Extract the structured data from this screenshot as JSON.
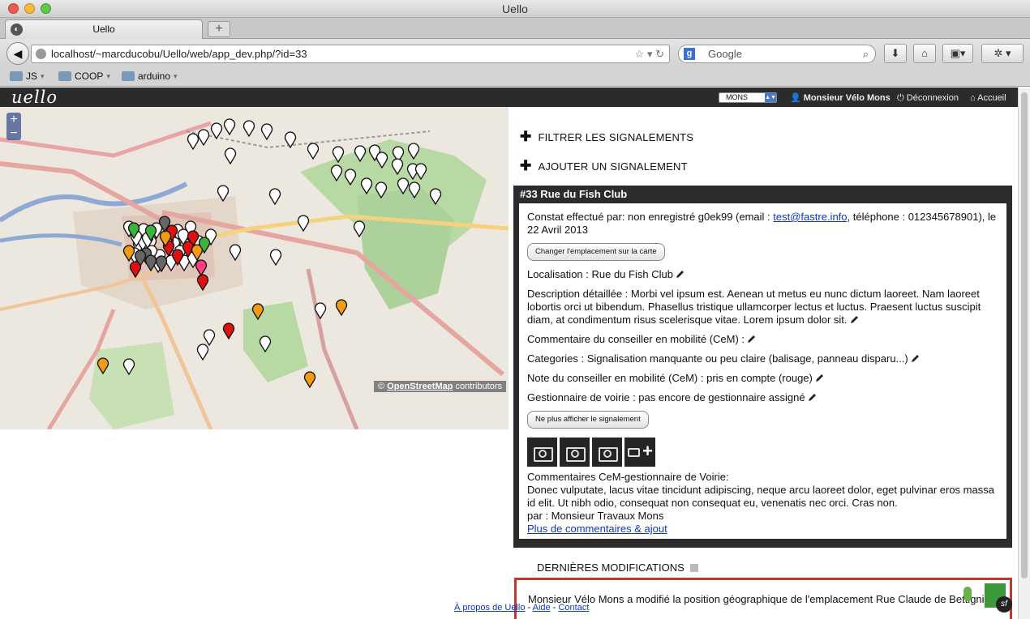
{
  "window": {
    "title": "Uello"
  },
  "browser": {
    "tab_label": "Uello",
    "new_tab": "+",
    "url": "localhost/~marcducobu/Uello/web/app_dev.php/?id=33",
    "search_placeholder": "Google",
    "bookmarks": [
      {
        "label": "JS"
      },
      {
        "label": "COOP"
      },
      {
        "label": "arduino"
      }
    ]
  },
  "app": {
    "logo": "uello",
    "city": "MONS",
    "user": "Monsieur Vélo Mons",
    "logout": "Déconnexion",
    "home": "Accueil"
  },
  "map": {
    "zoom_in": "+",
    "zoom_out": "−",
    "attribution_prefix": "©",
    "attribution_link": "OpenStreetMap",
    "attribution_suffix": "contributors",
    "markers": [
      {
        "color": "white",
        "count": 62
      },
      {
        "color": "red",
        "count": 8
      },
      {
        "color": "orange",
        "count": 7
      },
      {
        "color": "green",
        "count": 3
      },
      {
        "color": "grey",
        "count": 5
      },
      {
        "color": "pink",
        "count": 1
      }
    ]
  },
  "side": {
    "filter": "FILTRER LES SIGNALEMENTS",
    "add": "AJOUTER UN SIGNALEMENT"
  },
  "report": {
    "title": "#33 Rue du Fish Club",
    "constat_a": "Constat effectué par: non enregistré g0ek99 (email : ",
    "email": "test@fastre.info",
    "constat_b": ", téléphone : 012345678901), le 22 Avril 2013",
    "move_button": "Changer l'emplacement sur la carte",
    "localisation": "Localisation : Rue du Fish Club",
    "description": "Description détaillée : Morbi vel ipsum est. Aenean ut metus eu nunc dictum laoreet. Nam laoreet lobortis orci ut bibendum. Phasellus tristique ullamcorper lectus et luctus. Praesent luctus suscipit diam, at condimentum risus scelerisque vitae. Lorem ipsum dolor sit.",
    "comment_cem": "Commentaire du conseiller en mobilité (CeM) :",
    "categories": "Categories : Signalisation manquante ou peu claire (balisage, panneau disparu...)",
    "note": "Note du conseiller en mobilité (CeM) : pris en compte (rouge)",
    "gestionnaire": "Gestionnaire de voirie : pas encore de gestionnaire assigné",
    "hide_button": "Ne plus afficher le signalement",
    "comments_title": "Commentaires CeM-gestionnaire de Voirie:",
    "comments_text": "Donec vulputate, lacus vitae tincidunt adipiscing, neque arcu laoreet dolor, eget pulvinar eros massa id elit. Ut nibh odio, consequat non consequat eu, venenatis nec orci. Cras non.",
    "comments_by": "par : Monsieur Travaux Mons",
    "more_link": "Plus de commentaires & ajout"
  },
  "recent": {
    "title": "DERNIÈRES MODIFICATIONS",
    "item": "Monsieur Vélo Mons a modifié la position géographique de l'emplacement Rue Claude de Bettignies."
  },
  "footer": {
    "about": "À propos de Uello",
    "help": "Aide",
    "contact": "Contact",
    "sep": "-"
  },
  "colors": {
    "accent_red": "#c0392b",
    "dark": "#2c2c2c",
    "link": "#0b36c9"
  }
}
